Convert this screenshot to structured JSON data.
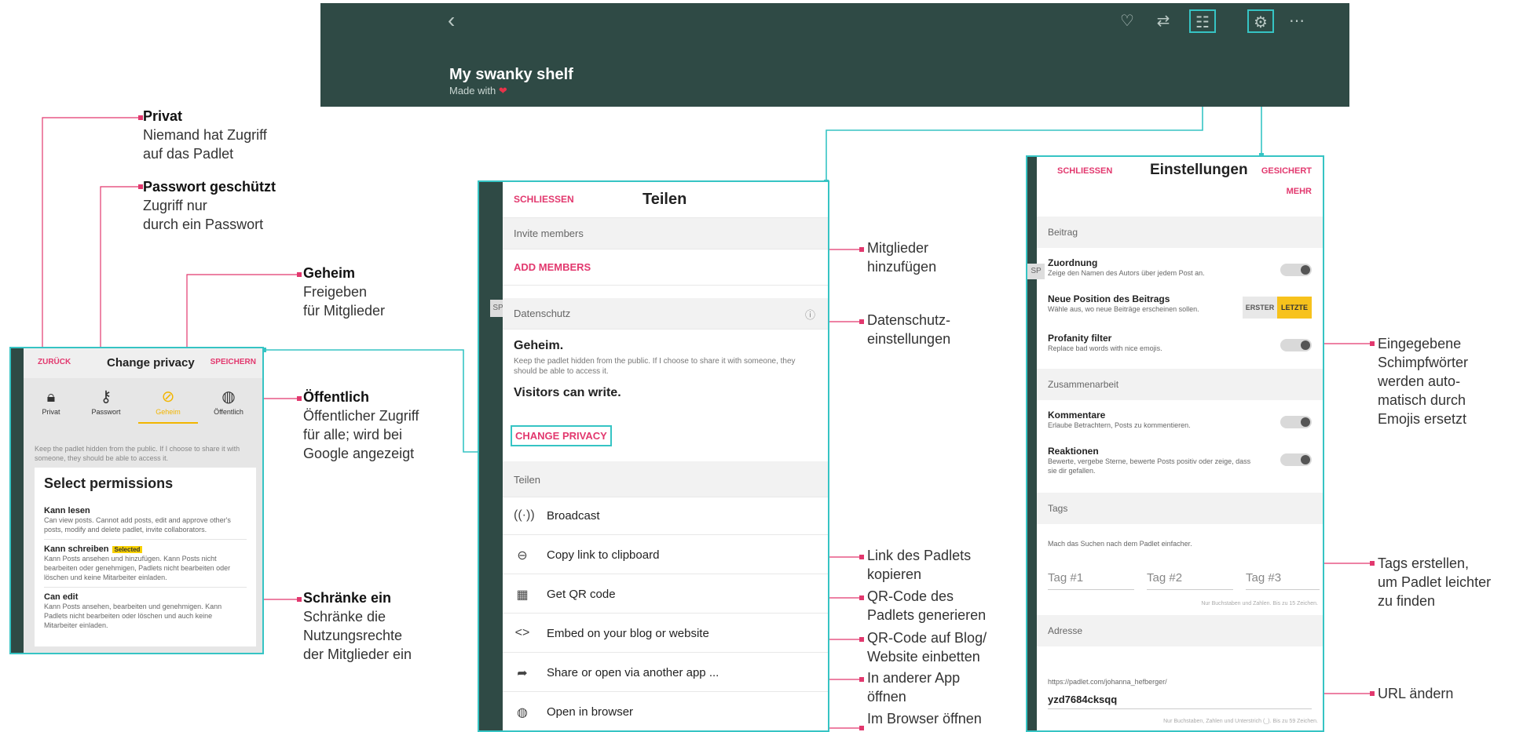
{
  "header": {
    "title": "My swanky shelf",
    "subtitle": "Made with",
    "back_icon": "chevron-left-icon",
    "icons": [
      "heart-icon",
      "remix-icon",
      "share-members-icon",
      "gear-icon",
      "more-icon"
    ]
  },
  "colors": {
    "header_bg": "#2f4a45",
    "accent_pink": "#e2386e",
    "highlight_cyan": "#36c4c4",
    "selected_yellow": "#f2b500",
    "annotation_marker": "#e2386e"
  },
  "privacy_panel": {
    "back": "ZURÜCK",
    "title": "Change privacy",
    "save": "SPEICHERN",
    "options": [
      {
        "label": "Privat",
        "icon": "lock-icon"
      },
      {
        "label": "Passwort",
        "icon": "key-icon"
      },
      {
        "label": "Geheim",
        "icon": "eye-off-icon"
      },
      {
        "label": "Öffentlich",
        "icon": "globe-icon"
      }
    ],
    "selected_option": "Geheim",
    "description": "Keep the padlet hidden from the public. If I choose to share it with someone, they should be able to access it.",
    "permissions_title": "Select permissions",
    "permissions": [
      {
        "title": "Kann lesen",
        "badge": "",
        "desc": "Can view posts. Cannot add posts, edit and approve other's posts, modify and delete padlet, invite collaborators."
      },
      {
        "title": "Kann schreiben",
        "badge": "Selected",
        "desc": "Kann Posts ansehen und hinzufügen. Kann Posts nicht bearbeiten oder genehmigen, Padlets nicht bearbeiten oder löschen und keine Mitarbeiter einladen."
      },
      {
        "title": "Can edit",
        "badge": "",
        "desc": "Kann Posts ansehen, bearbeiten und genehmigen. Kann Padlets nicht bearbeiten oder löschen und auch keine Mitarbeiter einladen."
      }
    ]
  },
  "share_panel": {
    "close": "SCHLIESSEN",
    "title": "Teilen",
    "invite_section": "Invite members",
    "add_members": "ADD MEMBERS",
    "privacy_section": "Datenschutz",
    "privacy_name": "Geheim.",
    "privacy_desc": "Keep the padlet hidden from the public. If I choose to share it with someone, they should be able to access it.",
    "visitors": "Visitors can write.",
    "change_privacy": "CHANGE PRIVACY",
    "share_section": "Teilen",
    "sp_tab": "SP",
    "items": [
      {
        "label": "Broadcast",
        "icon": "broadcast-icon"
      },
      {
        "label": "Copy link to clipboard",
        "icon": "link-icon"
      },
      {
        "label": "Get QR code",
        "icon": "qr-code-icon"
      },
      {
        "label": "Embed on your blog or website",
        "icon": "code-icon"
      },
      {
        "label": "Share or open via another app ...",
        "icon": "share-arrow-icon"
      },
      {
        "label": "Open in browser",
        "icon": "globe-icon"
      }
    ]
  },
  "settings_panel": {
    "close": "SCHLIESSEN",
    "title": "Einstellungen",
    "saved": "GESICHERT",
    "more": "MEHR",
    "sp_tab": "SP",
    "section_post": "Beitrag",
    "attribution_title": "Zuordnung",
    "attribution_desc": "Zeige den Namen des Autors über jedem Post an.",
    "position_title": "Neue Position des Beitrags",
    "position_desc": "Wähle aus, wo neue Beiträge erscheinen sollen.",
    "position_first": "ERSTER",
    "position_last": "LETZTE",
    "profanity_title": "Profanity filter",
    "profanity_desc": "Replace bad words with nice emojis.",
    "section_collab": "Zusammenarbeit",
    "comments_title": "Kommentare",
    "comments_desc": "Erlaube Betrachtern, Posts zu kommentieren.",
    "reactions_title": "Reaktionen",
    "reactions_desc": "Bewerte, vergebe Sterne, bewerte Posts positiv oder zeige, dass sie dir gefallen.",
    "section_tags": "Tags",
    "tags_desc": "Mach das Suchen nach dem Padlet einfacher.",
    "tags": [
      "Tag #1",
      "Tag #2",
      "Tag #3"
    ],
    "tags_hint": "Nur Buchstaben und Zahlen. Bis zu 15 Zeichen.",
    "section_address": "Adresse",
    "address_prefix": "https://padlet.com/johanna_hefberger/",
    "address_value": "yzd7684cksqq",
    "address_hint": "Nur Buchstaben, Zahlen und Unterstrich (_). Bis zu 59 Zeichen."
  },
  "annotations": {
    "privat": {
      "title": "Privat",
      "lines": [
        "Niemand hat Zugriff",
        "auf das Padlet"
      ]
    },
    "passwort": {
      "title": "Passwort geschützt",
      "lines": [
        "Zugriff nur",
        "durch ein Passwort"
      ]
    },
    "geheim": {
      "title": "Geheim",
      "lines": [
        "Freigeben",
        "für Mitglieder"
      ]
    },
    "oeffentlich": {
      "title": "Öffentlich",
      "lines": [
        "Öffentlicher Zugriff",
        "für alle; wird bei",
        "Google angezeigt"
      ]
    },
    "schraenke": {
      "title": "Schränke ein",
      "lines": [
        "Schränke die",
        "Nutzungsrechte",
        "der Mitglieder ein"
      ]
    },
    "mitglieder": [
      "Mitglieder",
      "hinzufügen"
    ],
    "datenschutz": [
      "Datenschutz-",
      "einstellungen"
    ],
    "link": [
      "Link des Padlets",
      "kopieren"
    ],
    "qr": [
      "QR-Code des",
      "Padlets generieren"
    ],
    "embed": [
      "QR-Code auf Blog/",
      "Website einbetten"
    ],
    "app": [
      "In anderer App",
      "öffnen"
    ],
    "browser": [
      "Im Browser öffnen"
    ],
    "profanity": [
      "Eingegebene",
      "Schimpfwörter",
      "werden auto-",
      "matisch durch",
      "Emojis ersetzt"
    ],
    "tags": [
      "Tags erstellen,",
      "um Padlet leichter",
      "zu finden"
    ],
    "url": [
      "URL ändern"
    ]
  }
}
